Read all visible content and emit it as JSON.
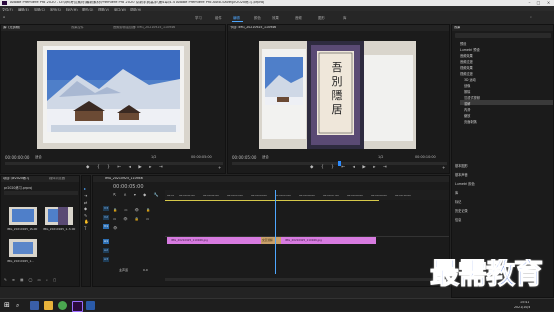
{
  "window": {
    "title": "Adobe Premiere Pro 2020 - D:\\qh\\考试素材\\最新素材\\Premiere Pro 2020 从新手到高手\\第4章\\4.4 Adobe Premiere Pro Auto-Save\\pr2020练习.prproj"
  },
  "menu": [
    "文件(F)",
    "编辑(E)",
    "剪辑(C)",
    "序列(S)",
    "标记(M)",
    "图形(G)",
    "视图(V)",
    "窗口(W)",
    "帮助(H)"
  ],
  "workspaces": [
    "学习",
    "组件",
    "编辑",
    "颜色",
    "效果",
    "音频",
    "图形",
    "库"
  ],
  "source": {
    "tab": "源: (无剪辑)",
    "tab2": "效果控件",
    "tab3": "音频剪辑混合器: IMG_20210925_110946",
    "timecode_left": "00:00:00:00",
    "fit": "适合",
    "ratio": "1/2",
    "timecode_right": "00:00:05:00"
  },
  "program": {
    "tab": "节目: IMG_20210925_110946",
    "timecode_left": "00:00:05:00",
    "fit": "适合",
    "ratio": "1/2",
    "timecode_right": "00:00:10:00",
    "card_text": "吾 別 隱 居"
  },
  "project": {
    "tab": "项目: pr2020练习",
    "tab2": "媒体浏览器",
    "path": "pr2020练习.prproj",
    "items": [
      {
        "name": "IMG_20210925_1...",
        "duration": "5:00"
      },
      {
        "name": "IMG_20210925_1...",
        "duration": "5:00"
      },
      {
        "name": "IMG_20210925_1...",
        "duration": ""
      }
    ]
  },
  "timeline": {
    "tab": "IMG_20210925_110946",
    "timecode": "00:00:05:00",
    "ruler": [
      "00:00",
      "00:00:01:00",
      "00:00:02:00",
      "00:00:03:00",
      "00:00:04:00",
      "00:00:05:00",
      "00:00:06:00",
      "00:00:07:00",
      "00:00:08:00",
      "00:00:09:00",
      "00:00:10:00"
    ],
    "tracks": [
      "V3",
      "V2",
      "V1",
      "A1",
      "A2",
      "A3"
    ],
    "master": "主声道",
    "master_val": "0.0",
    "clip1": "IMG_20210925_110946.jpg",
    "transition": "交叉溶解",
    "clip2": "IMG_20210925_110946.jpg"
  },
  "effects": {
    "title": "效果",
    "items": [
      "预设",
      "Lumetri 预设",
      "音频效果",
      "音频过渡",
      "视频效果",
      "视频过渡",
      "3D 运动",
      "划像",
      "擦除",
      "沉浸式视频",
      "溶解",
      "内滑",
      "缩放",
      "页面剥落"
    ],
    "panels": [
      "基本图形",
      "基本声音",
      "Lumetri 颜色",
      "库",
      "标记",
      "历史记录",
      "信息"
    ]
  },
  "taskbar": {
    "time": "15:41",
    "date": "2021/10/4"
  },
  "watermark": "最需教育",
  "colors": {
    "accent": "#2d8cff",
    "clip": "#d77be0",
    "transition": "#c9a06a"
  }
}
